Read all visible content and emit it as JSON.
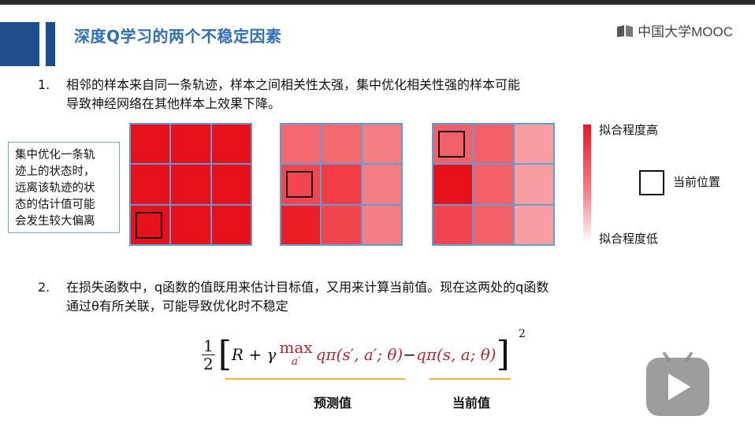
{
  "header": {
    "title": "深度Q学习的两个不稳定因素",
    "logo_text": "中国大学MOOC"
  },
  "points": [
    {
      "num": "1.",
      "line1": "相邻的样本来自同一条轨迹，样本之间相关性太强，集中优化相关性强的样本可能",
      "line2": "导致神经网络在其他样本上效果下降。"
    },
    {
      "num": "2.",
      "line1": "在损失函数中，q函数的值既用来估计目标值，又用来计算当前值。现在这两处的q函数",
      "line2": "通过θ有所关联，可能导致优化时不稳定"
    }
  ],
  "note_lines": [
    "集中优化一条轨",
    "迹上的状态时，",
    "远离该轨迹的状",
    "态的估计值可能",
    "会发生较大偏离"
  ],
  "grids": [
    {
      "colors": [
        "#e8101a",
        "#e8101a",
        "#e8101a",
        "#e8101a",
        "#e8101a",
        "#e8101a",
        "#e8101a",
        "#e8101a",
        "#e8101a"
      ],
      "marker_index": 6
    },
    {
      "colors": [
        "#f46a70",
        "#f46a70",
        "#f57e84",
        "#f24550",
        "#f43c44",
        "#f57e84",
        "#ec1e28",
        "#f2464e",
        "#f57e84"
      ],
      "marker_index": 3
    },
    {
      "colors": [
        "#f46068",
        "#f46068",
        "#f89ea3",
        "#e8101a",
        "#f46068",
        "#f89ea3",
        "#f24550",
        "#f46068",
        "#f89ea3"
      ],
      "marker_index": 0
    }
  ],
  "legend": {
    "high": "拟合程度高",
    "low": "拟合程度低",
    "current": "当前位置"
  },
  "formula": {
    "frac_num": "1",
    "frac_den": "2",
    "open": "[",
    "close": "]",
    "part1": "R + γ ",
    "max_word": "max",
    "max_sub": "a′",
    "part2": " qπ(s′, a′; θ)",
    "minus": " − ",
    "part3": "qπ(s, a; θ)",
    "exponent": "2"
  },
  "labels": {
    "predicted": "预测值",
    "current": "当前值"
  }
}
